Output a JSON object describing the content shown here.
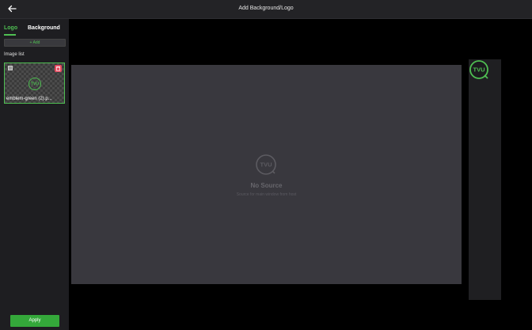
{
  "header": {
    "title": "Add Background/Logo",
    "back_icon": "arrow-left-icon"
  },
  "sidebar": {
    "tabs": [
      {
        "label": "Logo",
        "active": true
      },
      {
        "label": "Background",
        "active": false
      }
    ],
    "add_button_label": "+ Add",
    "image_list_label": "Image list",
    "images": [
      {
        "name": "emblem-green (2).p...",
        "selected": true,
        "logo_text": "TVU"
      }
    ],
    "apply_label": "Apply"
  },
  "preview": {
    "logo_text": "TVU",
    "title": "No Source",
    "subtitle": "Source for main window from host"
  },
  "overlay_logo": {
    "text": "TVU"
  },
  "colors": {
    "accent": "#4fbf52",
    "apply": "#34a83a",
    "delete": "#e84a5f",
    "preview_bg": "#39383e"
  }
}
